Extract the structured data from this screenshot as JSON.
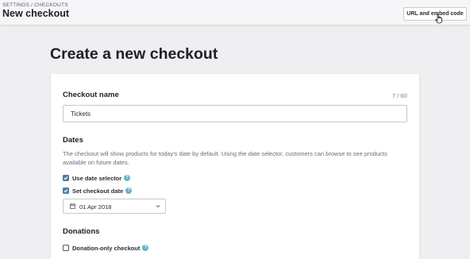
{
  "header": {
    "breadcrumb": "SETTINGS / CHECKOUTS",
    "title": "New checkout",
    "embed_button": "URL and embed code"
  },
  "page": {
    "title": "Create a new checkout"
  },
  "checkout_name": {
    "label": "Checkout name",
    "counter": "7 / 60",
    "value": "Tickets"
  },
  "dates": {
    "label": "Dates",
    "description": "The checkout will show products for today's date by default. Using the date selector, customers can browse to see products available on future dates.",
    "use_date_selector": {
      "label": "Use date selector",
      "checked": true
    },
    "set_checkout_date": {
      "label": "Set checkout date",
      "checked": true
    },
    "selected_date": "01 Apr 2018"
  },
  "donations": {
    "label": "Donations",
    "donation_only": {
      "label": "Donation-only checkout",
      "checked": false
    }
  },
  "colors": {
    "accent": "#4d7fa8",
    "help": "#62b3c9"
  }
}
